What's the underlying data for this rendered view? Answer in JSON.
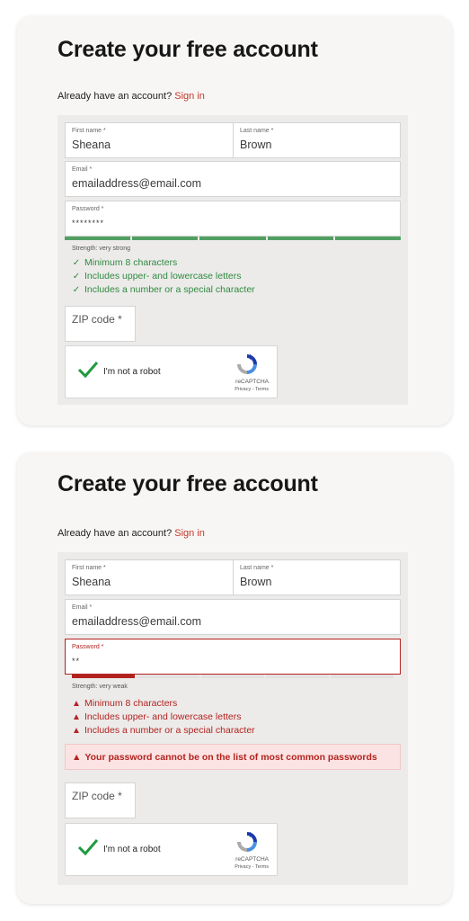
{
  "screen1": {
    "title": "Create your free account",
    "already_text": "Already have an account?",
    "sign_in": "Sign in",
    "first_name": {
      "label": "First name *",
      "value": "Sheana"
    },
    "last_name": {
      "label": "Last name *",
      "value": "Brown"
    },
    "email": {
      "label": "Email *",
      "value": "emailaddress@email.com"
    },
    "password": {
      "label": "Password *",
      "value": "********"
    },
    "strength": {
      "text": "Strength: very strong",
      "level": 5,
      "of": 5
    },
    "requirements": [
      {
        "text": "Minimum 8 characters",
        "status": "met"
      },
      {
        "text": "Includes upper- and lowercase letters",
        "status": "met"
      },
      {
        "text": "Includes a number or a special character",
        "status": "met"
      }
    ],
    "zip": {
      "placeholder": "ZIP code *"
    },
    "captcha": {
      "label": "I'm not a robot",
      "brand": "reCAPTCHA",
      "terms": "Privacy - Terms"
    }
  },
  "screen2": {
    "title": "Create your free account",
    "already_text": "Already have an account?",
    "sign_in": "Sign in",
    "first_name": {
      "label": "First name *",
      "value": "Sheana"
    },
    "last_name": {
      "label": "Last name *",
      "value": "Brown"
    },
    "email": {
      "label": "Email *",
      "value": "emailaddress@email.com"
    },
    "password": {
      "label": "Password *",
      "value": "**"
    },
    "strength": {
      "text": "Strength: very weak",
      "level": 1,
      "of": 5
    },
    "requirements": [
      {
        "text": "Minimum 8 characters",
        "status": "unmet"
      },
      {
        "text": "Includes upper- and lowercase letters",
        "status": "unmet"
      },
      {
        "text": "Includes a number or a special character",
        "status": "unmet"
      }
    ],
    "error": "Your password cannot be on the list of most common passwords",
    "zip": {
      "placeholder": "ZIP code *"
    },
    "captcha": {
      "label": "I'm not a robot",
      "brand": "reCAPTCHA",
      "terms": "Privacy - Terms"
    }
  },
  "colors": {
    "accent": "#c0392b",
    "strong": "#52a061",
    "weak": "#b2231f",
    "ok_text": "#2f8a3f"
  },
  "icons": {
    "met": "check-icon",
    "unmet": "warning-icon",
    "captcha_check": "check-icon",
    "captcha_logo": "recaptcha-logo-icon"
  }
}
